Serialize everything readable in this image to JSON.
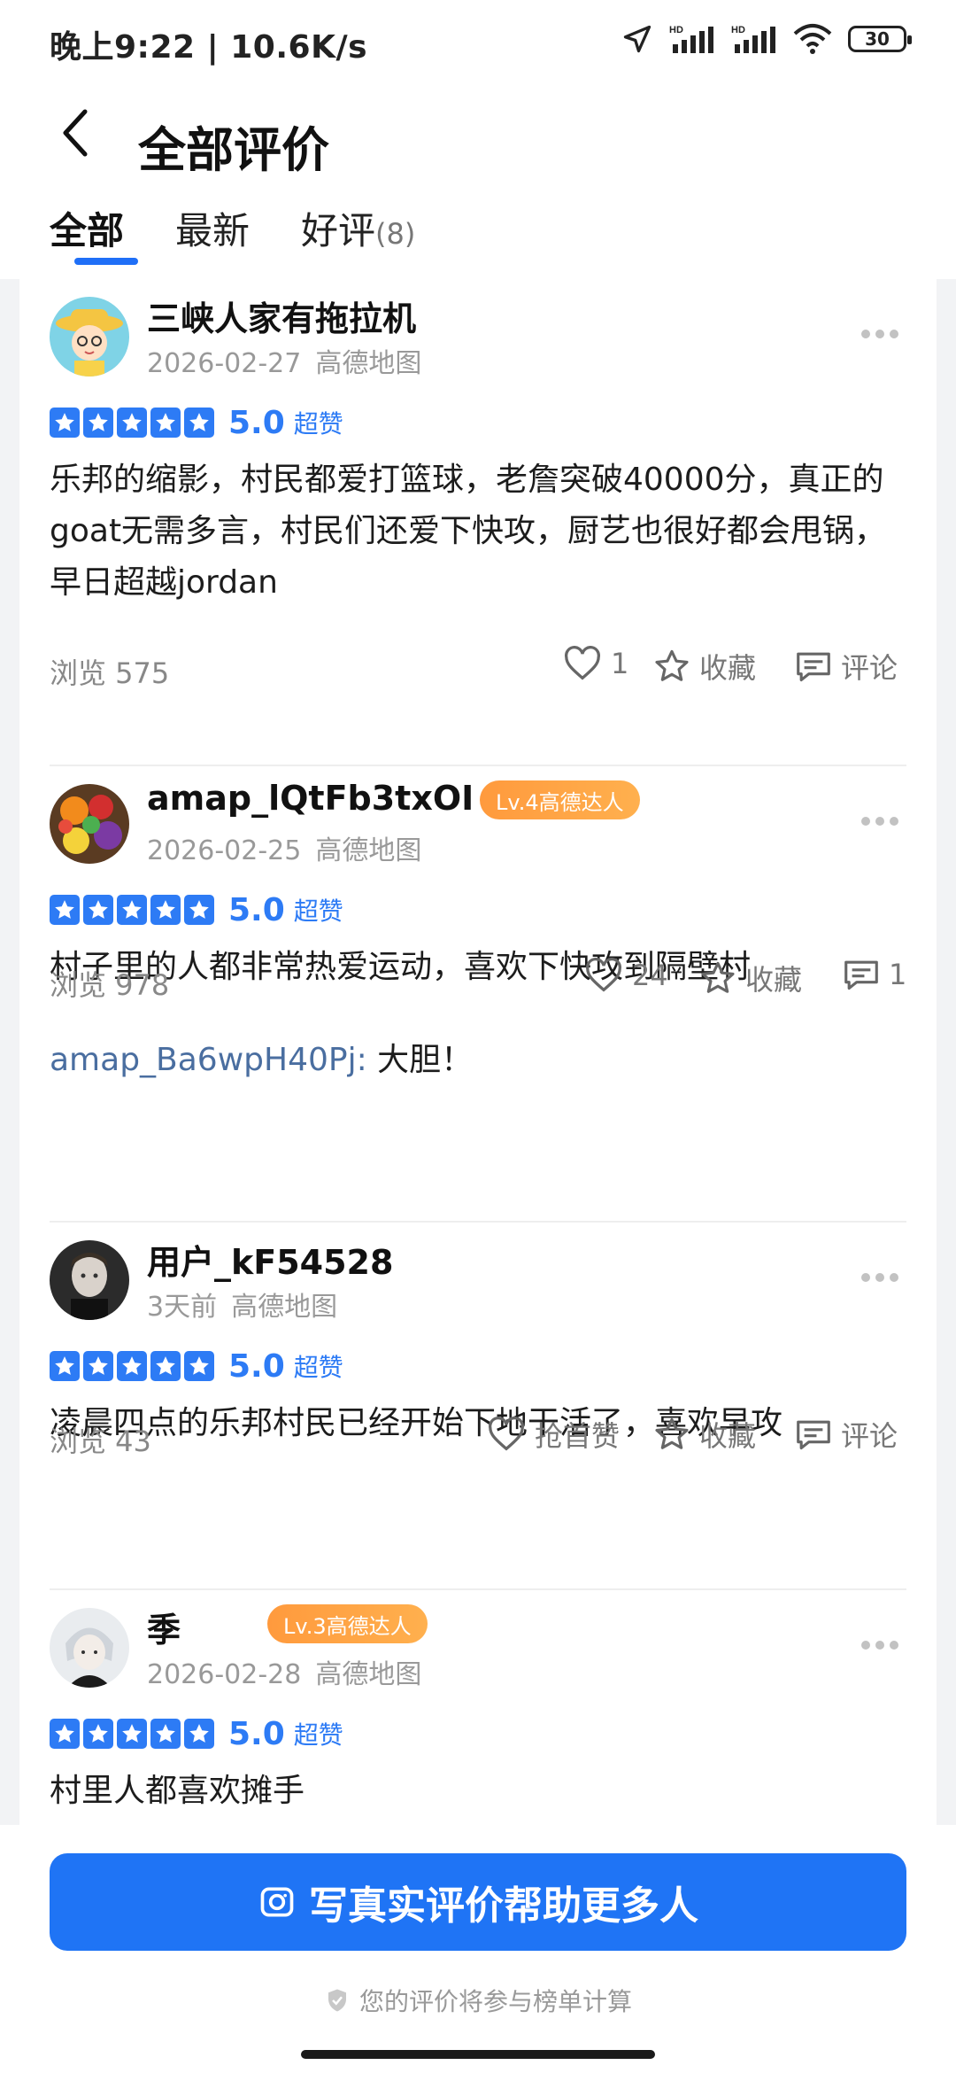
{
  "status_bar": {
    "time": "晚上9:22 | 10.6K/s",
    "battery": "30"
  },
  "header": {
    "title": "全部评价"
  },
  "tabs": [
    {
      "label": "全部",
      "active": true
    },
    {
      "label": "最新"
    },
    {
      "label": "好评",
      "count": "(8)"
    }
  ],
  "reviews": [
    {
      "user": "三峡人家有拖拉机",
      "date": "2026-02-27",
      "source": "高德地图",
      "stars": 5,
      "score": "5.0",
      "score_label": "超赞",
      "text": "乐邦的缩影，村民都爱打篮球，老詹突破40000分，真正的goat无需多言，村民们还爱下快攻，厨艺也很好都会甩锅，早日超越jordan",
      "views": "浏览 575",
      "likes": "1",
      "favorite": "收藏",
      "comment": "评论"
    },
    {
      "user": "amap_lQtFb3txOI",
      "badge": "Lv.4高德达人",
      "date": "2026-02-25",
      "source": "高德地图",
      "stars": 5,
      "score": "5.0",
      "score_label": "超赞",
      "text": "村子里的人都非常热爱运动，喜欢下快攻到隔壁村",
      "views": "浏览 978",
      "likes": "24",
      "favorite": "收藏",
      "comment": "1",
      "reply_user": "amap_Ba6wpH40Pj:",
      "reply_text": "大胆！"
    },
    {
      "user": "用户_kF54528",
      "date": "3天前",
      "source": "高德地图",
      "stars": 5,
      "score": "5.0",
      "score_label": "超赞",
      "text": "凌晨四点的乐邦村民已经开始下地干活了，喜欢早攻",
      "views": "浏览 43",
      "likes": "抢首赞",
      "favorite": "收藏",
      "comment": "评论"
    },
    {
      "user": "季",
      "badge": "Lv.3高德达人",
      "date": "2026-02-28",
      "source": "高德地图",
      "stars": 5,
      "score": "5.0",
      "score_label": "超赞",
      "text": "村里人都喜欢摊手"
    }
  ],
  "footer": {
    "cta_label": "写真实评价帮助更多人",
    "note": "您的评价将参与榜单计算"
  },
  "colors": {
    "accent": "#1f74f5",
    "badge": "#ff9a3d",
    "reply_name": "#4a6ea0"
  }
}
